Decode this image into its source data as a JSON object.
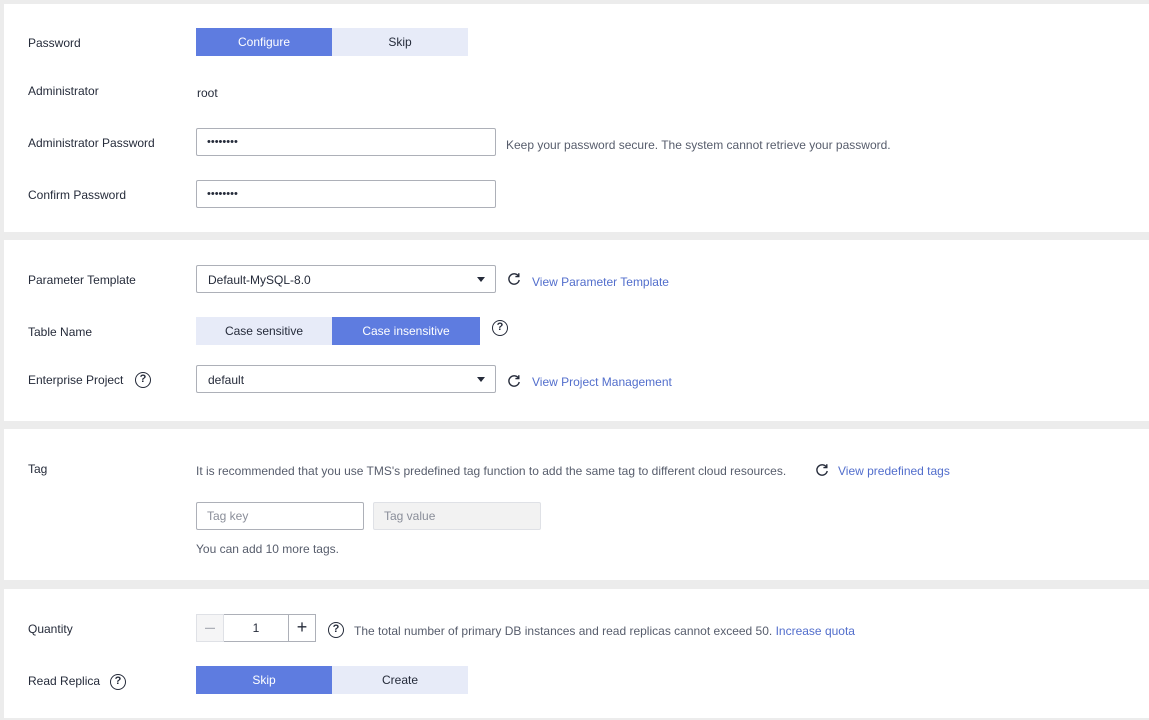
{
  "password_section": {
    "password_label": "Password",
    "password_options": [
      {
        "label": "Configure",
        "active": true
      },
      {
        "label": "Skip",
        "active": false
      }
    ],
    "admin_label": "Administrator",
    "admin_value": "root",
    "admin_password_label": "Administrator Password",
    "admin_password_value": "••••••••",
    "admin_password_hint": "Keep your password secure. The system cannot retrieve your password.",
    "confirm_password_label": "Confirm Password",
    "confirm_password_value": "••••••••"
  },
  "config_section": {
    "param_template_label": "Parameter Template",
    "param_template_value": "Default-MySQL-8.0",
    "param_template_link": "View Parameter Template",
    "table_name_label": "Table Name",
    "table_name_options": [
      {
        "label": "Case sensitive",
        "active": false
      },
      {
        "label": "Case insensitive",
        "active": true
      }
    ],
    "enterprise_project_label": "Enterprise Project",
    "enterprise_project_value": "default",
    "enterprise_project_link": "View Project Management"
  },
  "tag_section": {
    "tag_label": "Tag",
    "tag_hint": "It is recommended that you use TMS's predefined tag function to add the same tag to different cloud resources.",
    "tag_link": "View predefined tags",
    "tag_key_placeholder": "Tag key",
    "tag_value_placeholder": "Tag value",
    "tag_remaining": "You can add 10 more tags."
  },
  "quantity_section": {
    "quantity_label": "Quantity",
    "quantity_value": "1",
    "quantity_hint": "The total number of primary DB instances and read replicas cannot exceed 50.",
    "quantity_link": "Increase quota",
    "read_replica_label": "Read Replica",
    "read_replica_options": [
      {
        "label": "Skip",
        "active": true
      },
      {
        "label": "Create",
        "active": false
      }
    ]
  },
  "colors": {
    "accent": "#5e7ce0",
    "accent_light": "#e7ebf8",
    "link": "#526ecc"
  }
}
